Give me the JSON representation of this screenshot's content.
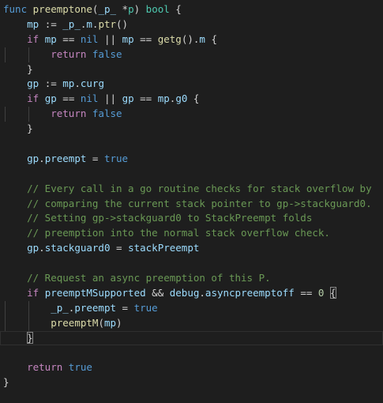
{
  "editor": {
    "language": "go",
    "theme_colors": {
      "background": "#1e1e1e",
      "keyword": "#569cd6",
      "control": "#c586c0",
      "function": "#dcdcaa",
      "variable": "#9cdcfe",
      "type": "#4ec9b0",
      "number": "#b5cea8",
      "comment": "#6a9955",
      "text": "#d4d4d4"
    },
    "current_line": 22,
    "lines": [
      {
        "indent": 0,
        "tokens": [
          [
            "kw",
            "func"
          ],
          [
            "op",
            " "
          ],
          [
            "fn",
            "preemptone"
          ],
          [
            "op",
            "("
          ],
          [
            "var",
            "_p_"
          ],
          [
            "op",
            " *"
          ],
          [
            "typ",
            "p"
          ],
          [
            "op",
            ") "
          ],
          [
            "typ",
            "bool"
          ],
          [
            "op",
            " {"
          ]
        ]
      },
      {
        "indent": 1,
        "tokens": [
          [
            "var",
            "mp"
          ],
          [
            "op",
            " := "
          ],
          [
            "var",
            "_p_"
          ],
          [
            "op",
            "."
          ],
          [
            "var",
            "m"
          ],
          [
            "op",
            "."
          ],
          [
            "fn",
            "ptr"
          ],
          [
            "op",
            "()"
          ]
        ]
      },
      {
        "indent": 1,
        "tokens": [
          [
            "ctl",
            "if"
          ],
          [
            "op",
            " "
          ],
          [
            "var",
            "mp"
          ],
          [
            "op",
            " == "
          ],
          [
            "kw",
            "nil"
          ],
          [
            "op",
            " || "
          ],
          [
            "var",
            "mp"
          ],
          [
            "op",
            " == "
          ],
          [
            "fn",
            "getg"
          ],
          [
            "op",
            "()."
          ],
          [
            "var",
            "m"
          ],
          [
            "op",
            " {"
          ]
        ]
      },
      {
        "indent": 2,
        "tokens": [
          [
            "ctl",
            "return"
          ],
          [
            "op",
            " "
          ],
          [
            "kw",
            "false"
          ]
        ]
      },
      {
        "indent": 1,
        "tokens": [
          [
            "op",
            "}"
          ]
        ]
      },
      {
        "indent": 1,
        "tokens": [
          [
            "var",
            "gp"
          ],
          [
            "op",
            " := "
          ],
          [
            "var",
            "mp"
          ],
          [
            "op",
            "."
          ],
          [
            "var",
            "curg"
          ]
        ]
      },
      {
        "indent": 1,
        "tokens": [
          [
            "ctl",
            "if"
          ],
          [
            "op",
            " "
          ],
          [
            "var",
            "gp"
          ],
          [
            "op",
            " == "
          ],
          [
            "kw",
            "nil"
          ],
          [
            "op",
            " || "
          ],
          [
            "var",
            "gp"
          ],
          [
            "op",
            " == "
          ],
          [
            "var",
            "mp"
          ],
          [
            "op",
            "."
          ],
          [
            "var",
            "g0"
          ],
          [
            "op",
            " {"
          ]
        ]
      },
      {
        "indent": 2,
        "tokens": [
          [
            "ctl",
            "return"
          ],
          [
            "op",
            " "
          ],
          [
            "kw",
            "false"
          ]
        ]
      },
      {
        "indent": 1,
        "tokens": [
          [
            "op",
            "}"
          ]
        ]
      },
      {
        "indent": 0,
        "tokens": []
      },
      {
        "indent": 1,
        "tokens": [
          [
            "var",
            "gp"
          ],
          [
            "op",
            "."
          ],
          [
            "var",
            "preempt"
          ],
          [
            "op",
            " = "
          ],
          [
            "kw",
            "true"
          ]
        ]
      },
      {
        "indent": 0,
        "tokens": []
      },
      {
        "indent": 1,
        "tokens": [
          [
            "cmt",
            "// Every call in a go routine checks for stack overflow by"
          ]
        ]
      },
      {
        "indent": 1,
        "tokens": [
          [
            "cmt",
            "// comparing the current stack pointer to gp->stackguard0."
          ]
        ]
      },
      {
        "indent": 1,
        "tokens": [
          [
            "cmt",
            "// Setting gp->stackguard0 to StackPreempt folds"
          ]
        ]
      },
      {
        "indent": 1,
        "tokens": [
          [
            "cmt",
            "// preemption into the normal stack overflow check."
          ]
        ]
      },
      {
        "indent": 1,
        "tokens": [
          [
            "var",
            "gp"
          ],
          [
            "op",
            "."
          ],
          [
            "var",
            "stackguard0"
          ],
          [
            "op",
            " = "
          ],
          [
            "var",
            "stackPreempt"
          ]
        ]
      },
      {
        "indent": 0,
        "tokens": []
      },
      {
        "indent": 1,
        "tokens": [
          [
            "cmt",
            "// Request an async preemption of this P."
          ]
        ]
      },
      {
        "indent": 1,
        "tokens": [
          [
            "ctl",
            "if"
          ],
          [
            "op",
            " "
          ],
          [
            "var",
            "preemptMSupported"
          ],
          [
            "op",
            " && "
          ],
          [
            "var",
            "debug"
          ],
          [
            "op",
            "."
          ],
          [
            "var",
            "asyncpreemptoff"
          ],
          [
            "op",
            " == "
          ],
          [
            "num",
            "0"
          ],
          [
            "op",
            " "
          ],
          [
            "brm",
            "{"
          ]
        ]
      },
      {
        "indent": 2,
        "tokens": [
          [
            "var",
            "_p_"
          ],
          [
            "op",
            "."
          ],
          [
            "var",
            "preempt"
          ],
          [
            "op",
            " = "
          ],
          [
            "kw",
            "true"
          ]
        ]
      },
      {
        "indent": 2,
        "tokens": [
          [
            "fn",
            "preemptM"
          ],
          [
            "op",
            "("
          ],
          [
            "var",
            "mp"
          ],
          [
            "op",
            ")"
          ]
        ]
      },
      {
        "indent": 1,
        "tokens": [
          [
            "brm",
            "}"
          ]
        ]
      },
      {
        "indent": 0,
        "tokens": []
      },
      {
        "indent": 1,
        "tokens": [
          [
            "ctl",
            "return"
          ],
          [
            "op",
            " "
          ],
          [
            "kw",
            "true"
          ]
        ]
      },
      {
        "indent": 0,
        "tokens": [
          [
            "op",
            "}"
          ]
        ]
      }
    ]
  }
}
